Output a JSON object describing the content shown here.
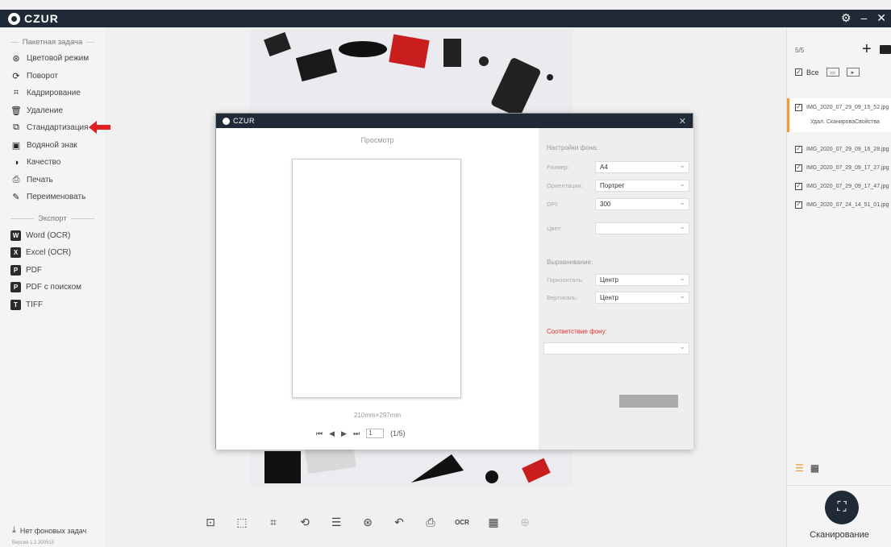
{
  "app": {
    "logo_text": "CZUR"
  },
  "top_controls": {
    "settings": "⚙",
    "minimize": "–",
    "close": "✕"
  },
  "sidebar": {
    "batch_title": "Пакетная задача",
    "batch_items": [
      {
        "label": "Цветовой режим",
        "icon": "color-mode-icon",
        "glyph": "⊛"
      },
      {
        "label": "Поворот",
        "icon": "rotate-icon",
        "glyph": "⟳"
      },
      {
        "label": "Кадрирование",
        "icon": "crop-icon",
        "glyph": "⌗"
      },
      {
        "label": "Удаление",
        "icon": "delete-icon",
        "glyph": "🗑"
      },
      {
        "label": "Стандартизация",
        "icon": "standardize-icon",
        "glyph": "⧉"
      },
      {
        "label": "Водяной знак",
        "icon": "watermark-icon",
        "glyph": "▣"
      },
      {
        "label": "Качество",
        "icon": "quality-icon",
        "glyph": "◑"
      },
      {
        "label": "Печать",
        "icon": "print-icon",
        "glyph": "⎙"
      },
      {
        "label": "Переименовать",
        "icon": "rename-icon",
        "glyph": "✎"
      }
    ],
    "export_title": "Экспорт",
    "export_items": [
      {
        "label": "Word (OCR)",
        "icon": "word-icon",
        "badge": "W"
      },
      {
        "label": "Excel (OCR)",
        "icon": "excel-icon",
        "badge": "X"
      },
      {
        "label": "PDF",
        "icon": "pdf-icon",
        "badge": "P"
      },
      {
        "label": "PDF с поиском",
        "icon": "searchable-pdf-icon",
        "badge": "P"
      },
      {
        "label": "TIFF",
        "icon": "tiff-icon",
        "badge": "T"
      }
    ],
    "background_tasks": "Нет фоновых задач",
    "version": "Версия 1.2.200515"
  },
  "right_panel": {
    "count": "5/5",
    "select_all": "Все",
    "files": [
      "IMG_2020_07_29_09_15_52.jpg",
      "IMG_2020_07_29_09_16_28.jpg",
      "IMG_2020_07_29_09_17_27.jpg",
      "IMG_2020_07_29_09_17_47.jpg",
      "IMG_2020_07_24_14_51_01.jpg"
    ],
    "file_actions": "Удал.  СканироваСвойства",
    "scan_label": "Сканирование"
  },
  "dialog": {
    "title": "CZUR",
    "preview_title": "Просмотр",
    "page_size": "210mm×297mm",
    "page_value": "1",
    "page_count": "(1/5)",
    "background_settings": "Настройки фона:",
    "size_label": "Размер:",
    "size_value": "A4",
    "orientation_label": "Ориентация:",
    "orientation_value": "Портрет",
    "dpi_label": "DPI:",
    "dpi_value": "300",
    "color_label": "Цвет:",
    "color_value": "",
    "alignment_title": "Выравнивание:",
    "horizontal_label": "Горизонталь:",
    "horizontal_value": "Центр",
    "vertical_label": "Вертикаль:",
    "vertical_value": "Центр",
    "match_background": "Соответствие фону:",
    "match_value": ""
  },
  "toolbar": {
    "tools": [
      "split-icon",
      "select-icon",
      "crop-icon",
      "rotate-icon",
      "adjust-icon",
      "color-icon",
      "undo-icon",
      "print-icon",
      "ocr-icon",
      "qr-icon",
      "merge-icon"
    ]
  },
  "colors": {
    "titlebar": "#1f2a36",
    "accent": "#f29a2e",
    "arrow": "#e02020",
    "red_text": "#e03030"
  }
}
